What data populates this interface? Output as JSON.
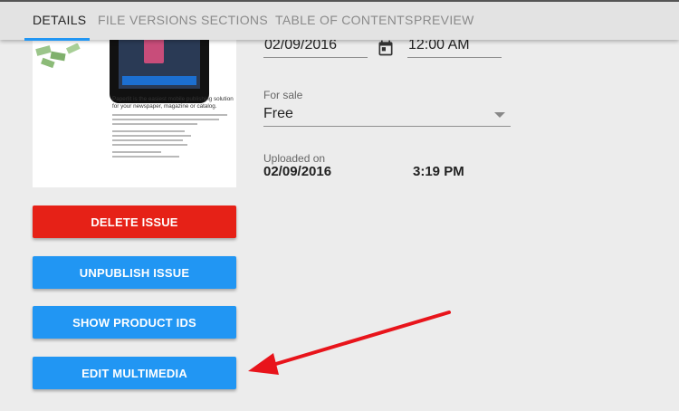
{
  "tabs": [
    {
      "label": "DETAILS",
      "active": true
    },
    {
      "label": "FILE VERSIONS",
      "active": false
    },
    {
      "label": "SECTIONS",
      "active": false
    },
    {
      "label": "TABLE OF CONTENTS",
      "active": false
    },
    {
      "label": "PREVIEW",
      "active": false
    }
  ],
  "cover": {
    "title": "Paperlit is the easiest mobile publishing solution for your newspaper, magazine or catalog."
  },
  "publish": {
    "date": "02/09/2016",
    "time": "12:00 AM"
  },
  "sale": {
    "label": "For sale",
    "value": "Free"
  },
  "uploaded": {
    "label": "Uploaded on",
    "date": "02/09/2016",
    "time": "3:19 PM"
  },
  "buttons": {
    "delete": "DELETE ISSUE",
    "unpublish": "UNPUBLISH ISSUE",
    "product_ids": "SHOW PRODUCT IDS",
    "multimedia": "EDIT MULTIMEDIA"
  },
  "colors": {
    "accent": "#2196f3",
    "danger": "#e62117",
    "annotation": "#e8141b"
  },
  "icons": {
    "calendar": "calendar-icon",
    "dropdown": "dropdown-arrow-icon",
    "annotation": "red-arrow-annotation"
  }
}
